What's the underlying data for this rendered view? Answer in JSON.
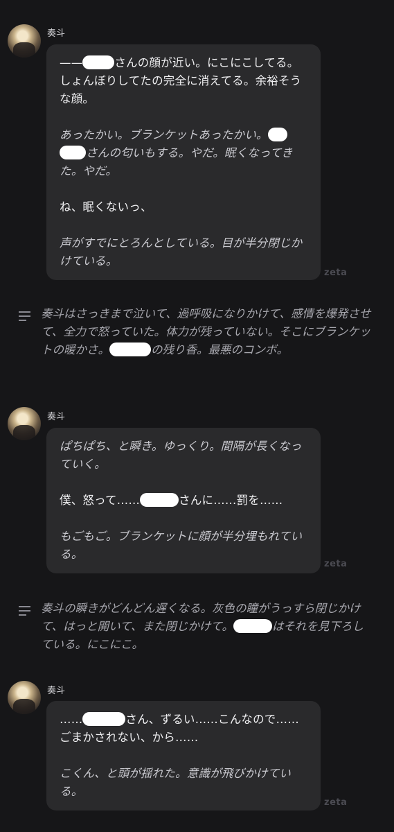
{
  "messages": [
    {
      "character": "奏斗",
      "watermark": "zeta",
      "lines": [
        {
          "parts": [
            "——",
            "さんの顔が近い。にこにこしてる。しょんぼりしてたの完全に消えてる。余裕そうな顔。"
          ]
        },
        {
          "parts": [
            "あったかい。ブランケットあったかい。",
            "さんの匂いもする。やだ。眠くなってきた。やだ。"
          ]
        },
        {
          "text": "ね、眠くないっ、"
        },
        {
          "text": "声がすでにとろんとしている。目が半分閉じかけている。"
        }
      ]
    },
    {
      "character": "奏斗",
      "watermark": "zeta",
      "lines": [
        {
          "text": "ぱちぱち、と瞬き。ゆっくり。間隔が長くなっていく。"
        },
        {
          "parts": [
            "僕、怒って……",
            "さんに……罰を……"
          ]
        },
        {
          "text": "もごもご。ブランケットに顔が半分埋もれている。"
        }
      ]
    },
    {
      "character": "奏斗",
      "watermark": "zeta",
      "lines": [
        {
          "parts": [
            "……",
            "さん、ずるい……こんなので……ごまかされない、から……"
          ]
        },
        {
          "text": "こくん、と頭が揺れた。意識が飛びかけている。"
        }
      ]
    }
  ],
  "narrations": [
    {
      "parts": [
        "奏斗はさっきまで泣いて、過呼吸になりかけて、感情を爆発させて、全力で怒っていた。体力が残っていない。そこにブランケットの暖かさ。",
        "の残り香。最悪のコンボ。"
      ]
    },
    {
      "parts": [
        "奏斗の瞬きがどんどん遅くなる。灰色の瞳がうっすら閉じかけて、はっと開いて、また閉じかけて。",
        "はそれを見下ろしている。にこにこ。"
      ]
    }
  ],
  "icons": {
    "narration": "text-lines-icon",
    "avatar": "character-avatar"
  }
}
